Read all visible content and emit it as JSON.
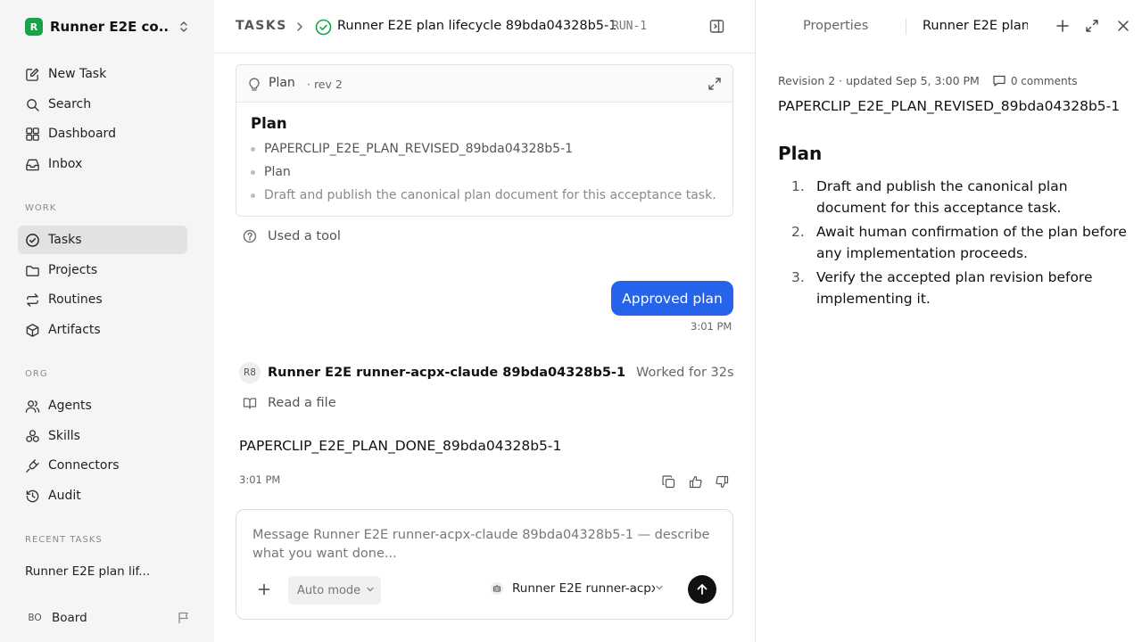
{
  "workspace": {
    "logo": "R",
    "name": "Runner E2E co..."
  },
  "sidebar": {
    "main": [
      {
        "label": "New Task",
        "icon": "edit-icon"
      },
      {
        "label": "Search",
        "icon": "search-icon"
      },
      {
        "label": "Dashboard",
        "icon": "dashboard-icon"
      },
      {
        "label": "Inbox",
        "icon": "inbox-icon"
      }
    ],
    "work_label": "WORK",
    "work": [
      {
        "label": "Tasks",
        "icon": "check-circle-icon",
        "active": true
      },
      {
        "label": "Projects",
        "icon": "folder-icon"
      },
      {
        "label": "Routines",
        "icon": "repeat-icon"
      },
      {
        "label": "Artifacts",
        "icon": "cube-icon"
      }
    ],
    "org_label": "ORG",
    "org": [
      {
        "label": "Agents",
        "icon": "users-icon"
      },
      {
        "label": "Skills",
        "icon": "skills-icon"
      },
      {
        "label": "Connectors",
        "icon": "plug-icon"
      },
      {
        "label": "Audit",
        "icon": "history-icon"
      }
    ],
    "recent_label": "RECENT TASKS",
    "recent": [
      "Runner E2E plan lif..."
    ],
    "board": {
      "initials": "BO",
      "name": "Board"
    }
  },
  "header": {
    "section": "TASKS",
    "title": "Runner E2E plan lifecycle 89bda04328b5-1",
    "id": "RUN-1"
  },
  "plan_card": {
    "title": "Plan",
    "rev": "· rev 2",
    "heading": "Plan",
    "bullets": [
      "PAPERCLIP_E2E_PLAN_REVISED_89bda04328b5-1",
      "Plan",
      "Draft and publish the canonical plan document for this acceptance task."
    ]
  },
  "tool_row": "Used a tool",
  "user_message": {
    "text": "Approved plan",
    "time": "3:01 PM"
  },
  "agent_message": {
    "initials": "R8",
    "name": "Runner E2E runner-acpx-claude 89bda04328b5-1",
    "worked": "Worked for 32s",
    "tool": "Read a file",
    "text": "PAPERCLIP_E2E_PLAN_DONE_89bda04328b5-1",
    "time": "3:01 PM"
  },
  "composer": {
    "placeholder": "Message Runner E2E runner-acpx-claude 89bda04328b5-1 — describe what you want done...",
    "mode": "Auto mode",
    "agent": "Runner E2E runner-acpx..."
  },
  "right_panel": {
    "tabs": [
      "Properties",
      "Runner E2E plan"
    ],
    "revision": "Revision 2 · updated Sep 5, 3:00 PM",
    "comments": "0 comments",
    "token": "PAPERCLIP_E2E_PLAN_REVISED_89bda04328b5-1",
    "heading": "Plan",
    "items": [
      "Draft and publish the canonical plan document for this acceptance task.",
      "Await human confirmation of the plan before any implementation proceeds.",
      "Verify the accepted plan revision before implementing it."
    ]
  },
  "colors": {
    "accent": "#2563eb",
    "brand": "#16a34a",
    "status": "#16a34a"
  }
}
